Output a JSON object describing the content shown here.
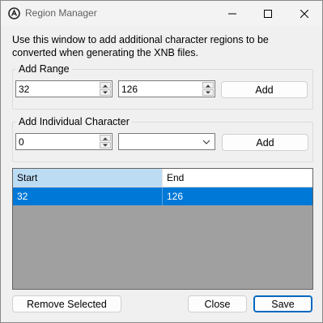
{
  "window": {
    "title": "Region Manager"
  },
  "description": "Use this window to add additional character regions to be converted when generating the XNB files.",
  "add_range": {
    "label": "Add Range",
    "start_value": "32",
    "end_value": "126",
    "add_label": "Add"
  },
  "add_individual": {
    "label": "Add Individual Character",
    "char_value": "0",
    "char_select": "",
    "add_label": "Add"
  },
  "grid": {
    "columns": [
      "Start",
      "End"
    ],
    "rows": [
      {
        "start": "32",
        "end": "126",
        "selected": true
      }
    ]
  },
  "buttons": {
    "remove_selected": "Remove Selected",
    "close": "Close",
    "save": "Save"
  },
  "colors": {
    "accent": "#0078d7",
    "selected_header": "#bcdcf4",
    "grid_background": "#a0a0a0"
  }
}
